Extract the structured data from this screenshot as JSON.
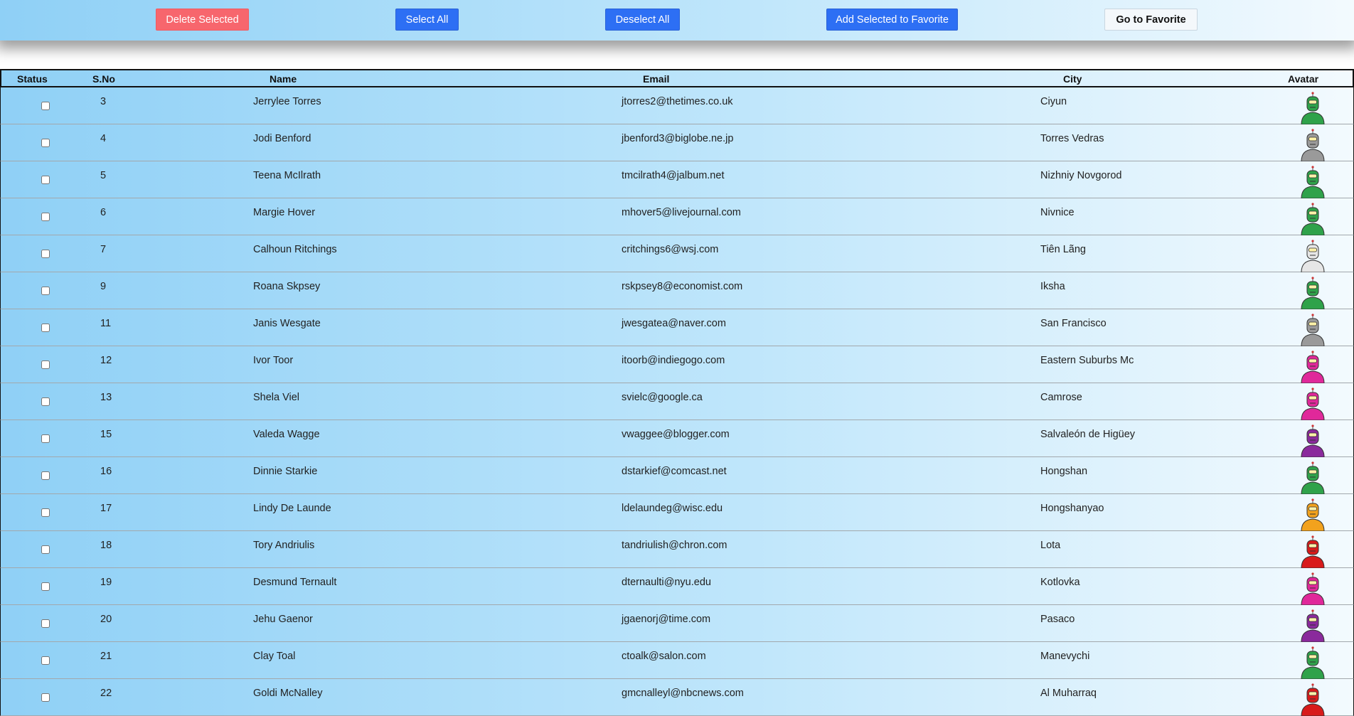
{
  "toolbar": {
    "delete_label": "Delete Selected",
    "select_all_label": "Select All",
    "deselect_all_label": "Deselect All",
    "add_favorite_label": "Add Selected to Favorite",
    "go_favorite_label": "Go to Favorite"
  },
  "colors": {
    "danger": "#f7666d",
    "primary": "#2d6ff4",
    "gradient_start": "#8fd0f6",
    "gradient_end": "#f3fafe"
  },
  "table": {
    "headers": {
      "status": "Status",
      "sno": "S.No",
      "name": "Name",
      "email": "Email",
      "city": "City",
      "avatar": "Avatar"
    },
    "rows": [
      {
        "sno": "3",
        "name": "Jerrylee Torres",
        "email": "jtorres2@thetimes.co.uk",
        "city": "Ciyun",
        "avatar_color": "#2fa24a",
        "checked": false
      },
      {
        "sno": "4",
        "name": "Jodi Benford",
        "email": "jbenford3@biglobe.ne.jp",
        "city": "Torres Vedras",
        "avatar_color": "#9a9a9a",
        "checked": false
      },
      {
        "sno": "5",
        "name": "Teena McIlrath",
        "email": "tmcilrath4@jalbum.net",
        "city": "Nizhniy Novgorod",
        "avatar_color": "#2fa24a",
        "checked": false
      },
      {
        "sno": "6",
        "name": "Margie Hover",
        "email": "mhover5@livejournal.com",
        "city": "Nivnice",
        "avatar_color": "#2fa24a",
        "checked": false
      },
      {
        "sno": "7",
        "name": "Calhoun Ritchings",
        "email": "critchings6@wsj.com",
        "city": "Tiên Lãng",
        "avatar_color": "#e6e6e6",
        "checked": false
      },
      {
        "sno": "9",
        "name": "Roana Skpsey",
        "email": "rskpsey8@economist.com",
        "city": "Iksha",
        "avatar_color": "#2fa24a",
        "checked": false
      },
      {
        "sno": "11",
        "name": "Janis Wesgate",
        "email": "jwesgatea@naver.com",
        "city": "San Francisco",
        "avatar_color": "#9a9a9a",
        "checked": false
      },
      {
        "sno": "12",
        "name": "Ivor Toor",
        "email": "itoorb@indiegogo.com",
        "city": "Eastern Suburbs Mc",
        "avatar_color": "#e0289a",
        "checked": false
      },
      {
        "sno": "13",
        "name": "Shela Viel",
        "email": "svielc@google.ca",
        "city": "Camrose",
        "avatar_color": "#e0289a",
        "checked": false
      },
      {
        "sno": "15",
        "name": "Valeda Wagge",
        "email": "vwaggee@blogger.com",
        "city": "Salvaleón de Higüey",
        "avatar_color": "#8a2a9c",
        "checked": false
      },
      {
        "sno": "16",
        "name": "Dinnie Starkie",
        "email": "dstarkief@comcast.net",
        "city": "Hongshan",
        "avatar_color": "#2fa24a",
        "checked": false
      },
      {
        "sno": "17",
        "name": "Lindy De Launde",
        "email": "ldelaundeg@wisc.edu",
        "city": "Hongshanyao",
        "avatar_color": "#f2a21d",
        "checked": false
      },
      {
        "sno": "18",
        "name": "Tory Andriulis",
        "email": "tandriulish@chron.com",
        "city": "Lota",
        "avatar_color": "#d81b1b",
        "checked": false
      },
      {
        "sno": "19",
        "name": "Desmund Ternault",
        "email": "dternaulti@nyu.edu",
        "city": "Kotlovka",
        "avatar_color": "#e0289a",
        "checked": false
      },
      {
        "sno": "20",
        "name": "Jehu Gaenor",
        "email": "jgaenorj@time.com",
        "city": "Pasaco",
        "avatar_color": "#8a2a9c",
        "checked": false
      },
      {
        "sno": "21",
        "name": "Clay Toal",
        "email": "ctoalk@salon.com",
        "city": "Manevychi",
        "avatar_color": "#2fa24a",
        "checked": false
      },
      {
        "sno": "22",
        "name": "Goldi McNalley",
        "email": "gmcnalleyl@nbcnews.com",
        "city": "Al Muharraq",
        "avatar_color": "#d81b1b",
        "checked": false
      }
    ]
  }
}
